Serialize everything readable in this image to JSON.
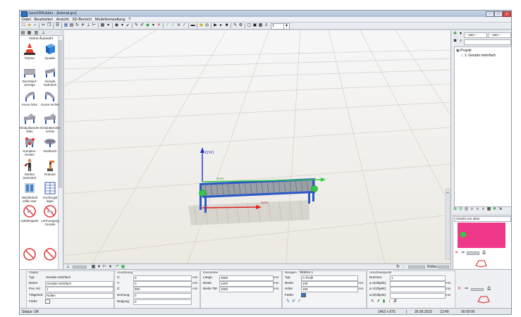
{
  "window": {
    "title": "JaraVRBuilder - [tutorial.jpv]"
  },
  "menu": [
    "Datei",
    "Bearbeiten",
    "Ansicht",
    "3D-Bereich",
    "Modellverwaltung",
    "?"
  ],
  "toolbar": {
    "layer_value": "1"
  },
  "palette": {
    "header": "meine Auswahl",
    "items": [
      {
        "label": "Pylone",
        "icon": "cone-icon"
      },
      {
        "label": "Quader",
        "icon": "cube-icon"
      },
      {
        "label": "Durchlauf-anzeige",
        "icon": "flow-rack-icon"
      },
      {
        "label": "Gerade mehrfach",
        "icon": "straight-conveyor-icon"
      },
      {
        "label": "Kurve links",
        "icon": "curve-left-icon"
      },
      {
        "label": "Kurve rechts",
        "icon": "curve-right-icon"
      },
      {
        "label": "Einlaufweiche links",
        "icon": "switch-left-icon"
      },
      {
        "label": "Einlaufweiche rechts",
        "icon": "switch-right-icon"
      },
      {
        "label": "Komplex-knoten",
        "icon": "complex-node-icon"
      },
      {
        "label": "Drehtisch",
        "icon": "turntable-icon"
      },
      {
        "label": "Werker (animiert)",
        "icon": "worker-icon"
      },
      {
        "label": "Roboter",
        "icon": "robot-icon"
      },
      {
        "label": "Wicklerbelt stille rotor",
        "icon": "belt-icon"
      },
      {
        "label": "Hochregal lager",
        "icon": "rack-icon"
      },
      {
        "label": "Gabelstapler",
        "icon": "forklift-icon"
      },
      {
        "label": "Lehrvorgang Gerade",
        "icon": "no-entry-icon"
      }
    ]
  },
  "viewport": {
    "axis_z": "Z(W)",
    "axis_y": "Y(W)",
    "axis_x": "X(W)"
  },
  "viewport_toolbar": {
    "rollen_label": "Rollen"
  },
  "right_panel": {
    "auto_1": "-- auto --",
    "auto_2": "-- auto --",
    "tree_root": "Projekt",
    "tree_child": "1: Gerade mehrfach",
    "view_label": "Ansicht von oben"
  },
  "bottom": {
    "objekt": {
      "title": "Objekt",
      "typ_label": "Typ:",
      "typ_value": "Gerade mehrfach",
      "name_label": "Name:",
      "name_value": "Gerade mehrfach",
      "pos_label": "Pos.-Nr.:",
      "pos_value": "1",
      "traeger_label": "Trägerteil:",
      "traeger_value": "Rollen",
      "farbe_label": "Farbe"
    },
    "anordnung": {
      "title": "Anordnung",
      "x_label": "X:",
      "x_value": "0",
      "y_label": "Y:",
      "y_value": "0",
      "z_label": "Z:",
      "z_value": "900",
      "drehung_label": "Drehung:",
      "drehung_value": "0",
      "neigung_label": "Neigung:",
      "neigung_value": "0",
      "unit": "mm"
    },
    "geometrie": {
      "title": "Geometrie",
      "laenge_label": "Länge:",
      "laenge_value": "4000",
      "breite_label": "Breite:",
      "breite_value": "1200",
      "breite_tm_label": "Breite TM:",
      "breite_tm_value": "1000",
      "unit": "mm"
    },
    "wangen": {
      "title": "Wangen",
      "tab2": "Stützen 1",
      "typ_label": "Typ:",
      "typ_value": "C-Profil",
      "breite_label": "Breite:",
      "breite_value": "100",
      "hoehe_label": "Höhe:",
      "hoehe_value": "150",
      "farbe_label": "Farbe:",
      "unit": "mm"
    },
    "anschluss": {
      "title": "Anschlusspunkt",
      "nummer_label": "Nummer:",
      "nummer_value": "1",
      "dx_label": "Δ X(Objekt):",
      "dy_label": "Δ Y(Objekt):",
      "dz_label": "Δ Z(Objekt):",
      "unit": "mm"
    }
  },
  "status": {
    "text": "Status: OK",
    "size": "1462 x 675",
    "date": "26.05.2015",
    "time": "13:49",
    "elapsed": "00:00:00"
  },
  "colors": {
    "minimap_bg": "#f0388a",
    "accent_green": "#2ecc40"
  }
}
